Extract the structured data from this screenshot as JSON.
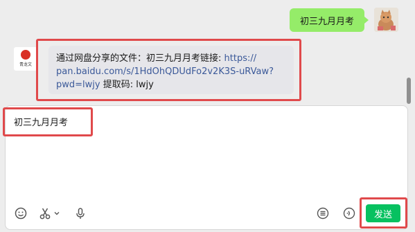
{
  "chat": {
    "outgoing_message": "初三九月月考",
    "incoming_message": {
      "prefix": "通过网盘分享的文件：初三九月月考链接: ",
      "link": "https://pan.baidu.com/s/1HdOhQDUdFo2v2K3S-uRVaw?pwd=lwjy",
      "line1_text": "通过网盘分享的文件：初三九月月考链接: ",
      "line1_link": "https://",
      "line2_link": "pan.baidu.com/s/1HdOhQDUdFo2v2K3S-uRVaw?",
      "line3_link": "pwd=lwjy",
      "line3_text": " 提取码: lwjy"
    },
    "other_avatar_label": "青龙文"
  },
  "composer": {
    "draft_text": "初三九月月考",
    "send_label": "发送"
  },
  "toolbar": {
    "icons": [
      "emoji-icon",
      "scissors-icon",
      "chevron-down-icon",
      "microphone-icon",
      "list-icon",
      "voice-message-icon"
    ]
  },
  "colors": {
    "outgoing_bubble": "#95ec69",
    "incoming_bubble": "#e6e6ea",
    "link": "#3b5999",
    "send_button": "#07c160",
    "highlight": "#e0494b"
  }
}
